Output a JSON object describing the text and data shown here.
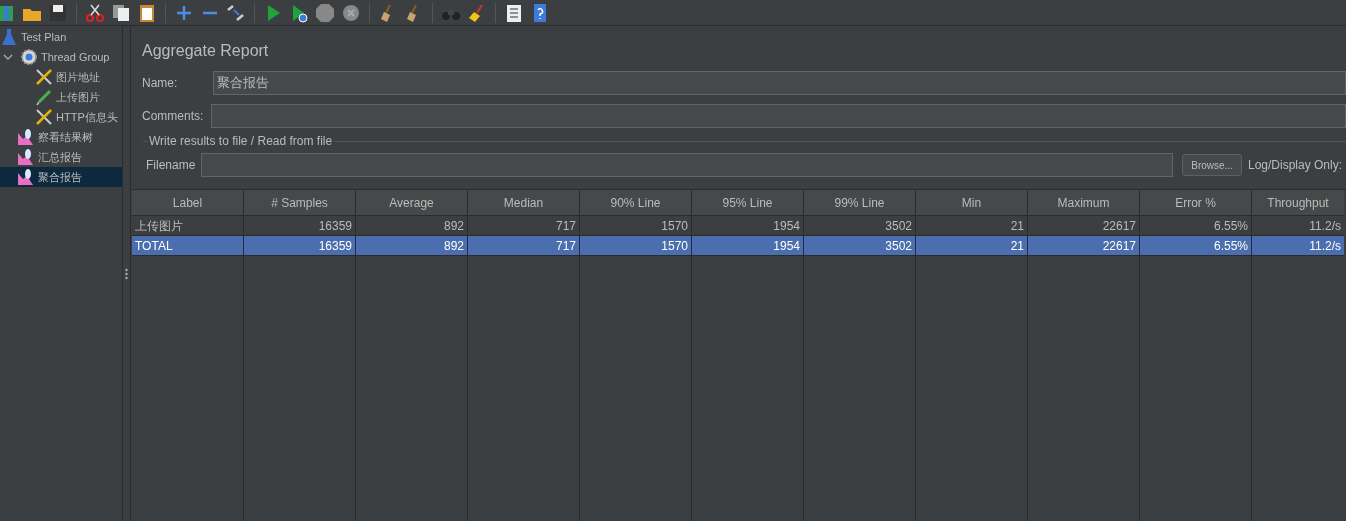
{
  "tree": [
    {
      "label": "Test Plan",
      "kind": "plan",
      "selected": false,
      "children": [
        {
          "label": "Thread Group",
          "kind": "group",
          "selected": false,
          "expanded": true,
          "children": [
            {
              "label": "图片地址",
              "kind": "config",
              "selected": false
            },
            {
              "label": "上传图片",
              "kind": "sampler",
              "selected": false
            },
            {
              "label": "HTTP信息头",
              "kind": "config",
              "selected": false
            }
          ]
        },
        {
          "label": "察看结果树",
          "kind": "listener",
          "selected": false
        },
        {
          "label": "汇总报告",
          "kind": "listener",
          "selected": false
        },
        {
          "label": "聚合报告",
          "kind": "listener",
          "selected": true
        }
      ]
    }
  ],
  "panel": {
    "title": "Aggregate Report",
    "name_label": "Name:",
    "name_value": "聚合报告",
    "comments_label": "Comments:",
    "file_section": "Write results to file / Read from file",
    "filename_label": "Filename",
    "browse_button": "Browse...",
    "log_label": "Log/Display Only:"
  },
  "table": {
    "columns": [
      "Label",
      "# Samples",
      "Average",
      "Median",
      "90% Line",
      "95% Line",
      "99% Line",
      "Min",
      "Maximum",
      "Error %",
      "Throughput"
    ],
    "rows": [
      {
        "selected": false,
        "cells": [
          "上传图片",
          "16359",
          "892",
          "717",
          "1570",
          "1954",
          "3502",
          "21",
          "22617",
          "6.55%",
          "11.2/s"
        ]
      },
      {
        "selected": true,
        "cells": [
          "TOTAL",
          "16359",
          "892",
          "717",
          "1570",
          "1954",
          "3502",
          "21",
          "22617",
          "6.55%",
          "11.2/s"
        ]
      }
    ]
  }
}
